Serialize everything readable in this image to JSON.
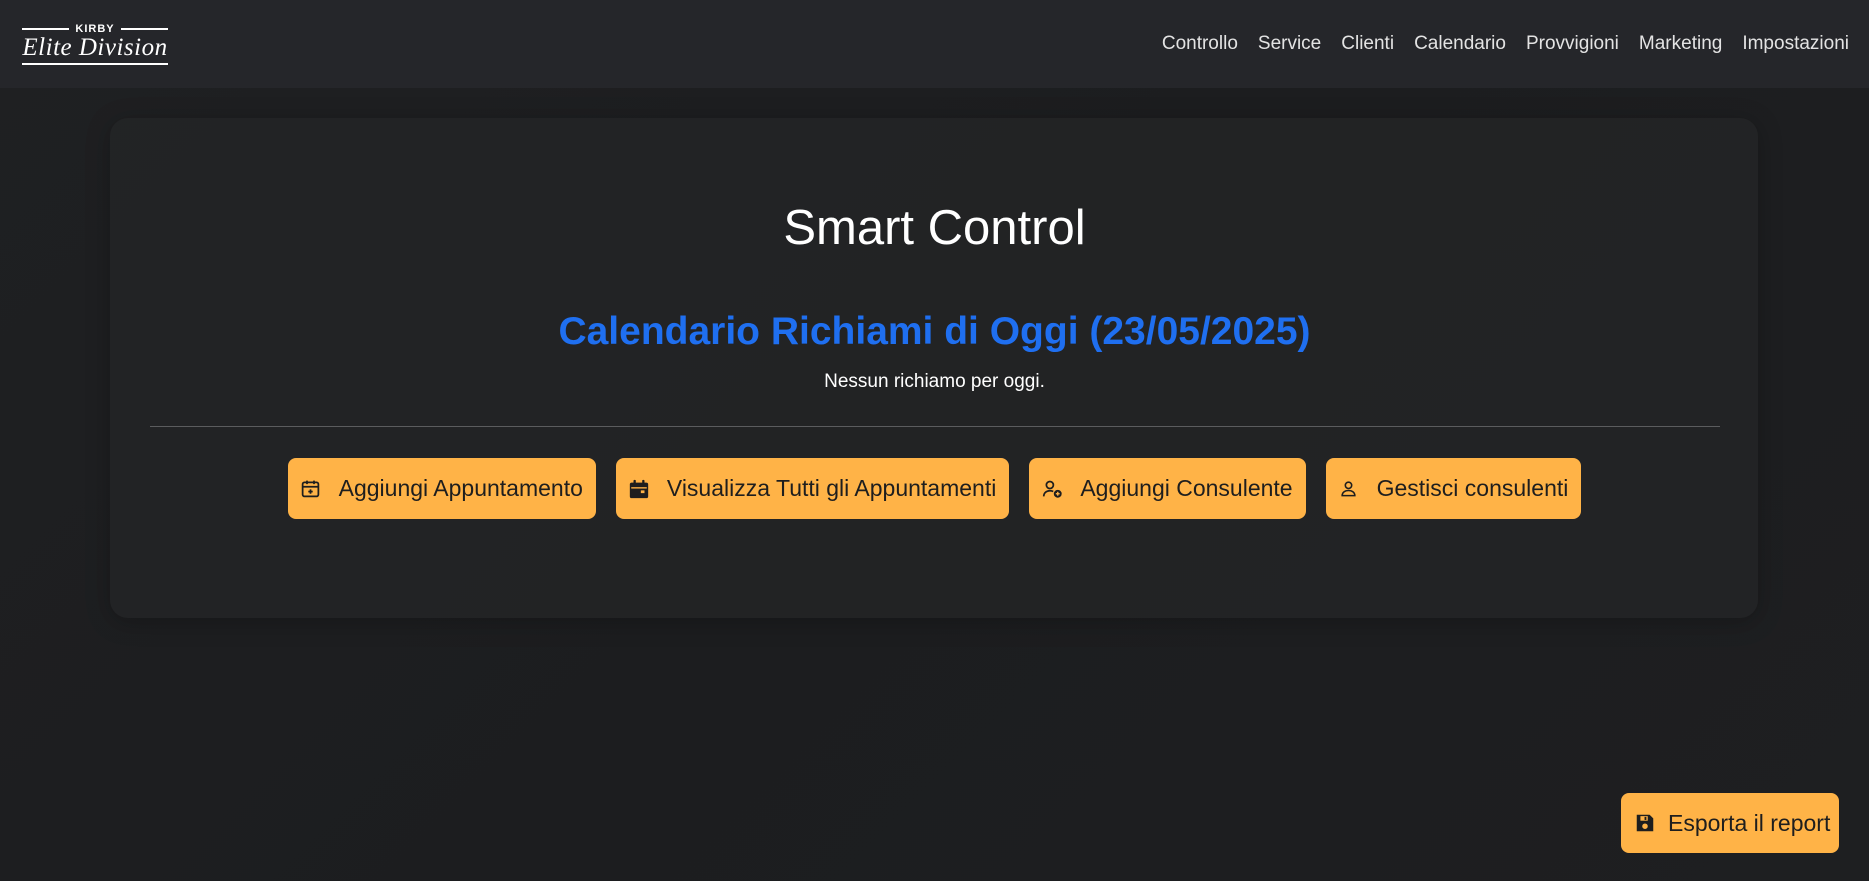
{
  "logo": {
    "brand_top": "KIRBY",
    "brand_script": "Elite Division"
  },
  "nav": {
    "items": [
      {
        "label": "Controllo"
      },
      {
        "label": "Service"
      },
      {
        "label": "Clienti"
      },
      {
        "label": "Calendario"
      },
      {
        "label": "Provvigioni"
      },
      {
        "label": "Marketing"
      },
      {
        "label": "Impostazioni"
      }
    ]
  },
  "main": {
    "title": "Smart Control",
    "calendar_heading": "Calendario Richiami di Oggi (23/05/2025)",
    "empty_message": "Nessun richiamo per oggi."
  },
  "actions": [
    {
      "label": "Aggiungi Appuntamento",
      "icon": "calendar-plus-icon"
    },
    {
      "label": "Visualizza Tutti gli Appuntamenti",
      "icon": "calendar-icon"
    },
    {
      "label": "Aggiungi Consulente",
      "icon": "user-plus-icon"
    },
    {
      "label": "Gestisci consulenti",
      "icon": "user-icon"
    }
  ],
  "export": {
    "label": "Esporta il report",
    "icon": "save-icon"
  },
  "colors": {
    "accent": "#ffb347",
    "heading_blue": "#1f6ff0",
    "navbar_bg": "#25262a",
    "page_bg": "#1d1e20"
  }
}
